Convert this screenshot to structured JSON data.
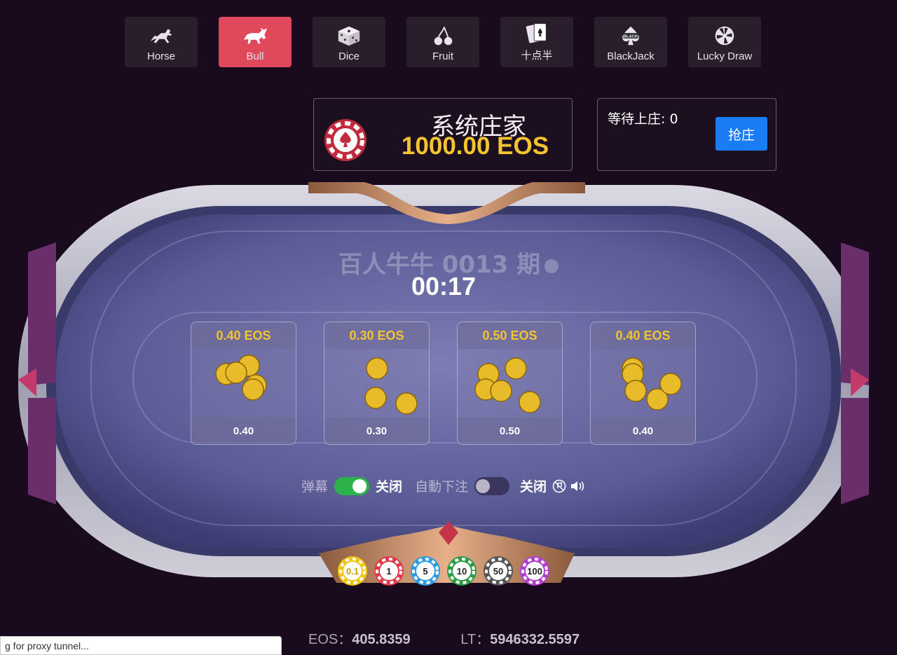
{
  "tabs": [
    {
      "label": "Horse",
      "icon": "horse-icon",
      "active": false
    },
    {
      "label": "Bull",
      "icon": "bull-icon",
      "active": true
    },
    {
      "label": "Dice",
      "icon": "dice-icon",
      "active": false
    },
    {
      "label": "Fruit",
      "icon": "cherry-icon",
      "active": false
    },
    {
      "label": "十点半",
      "icon": "playing-cards-icon",
      "active": false
    },
    {
      "label": "BlackJack",
      "icon": "blackjack-icon",
      "active": false
    },
    {
      "label": "Lucky Draw",
      "icon": "wheel-icon",
      "active": false
    }
  ],
  "banker": {
    "title": "系统庄家",
    "amount": "1000.00 EOS",
    "icon": "poker-chip-icon"
  },
  "queue": {
    "label": "等待上庄: 0",
    "button": "抢庄"
  },
  "round": {
    "title": "百人牛牛 0013 期",
    "timer": "00:17"
  },
  "bets": [
    {
      "header": "0.40 EOS",
      "footer": "0.40"
    },
    {
      "header": "0.30 EOS",
      "footer": "0.30"
    },
    {
      "header": "0.50 EOS",
      "footer": "0.50"
    },
    {
      "header": "0.40 EOS",
      "footer": "0.40"
    }
  ],
  "controls": {
    "barrage_label": "弹幕",
    "barrage_state": "关闭",
    "autobet_label": "自動下注",
    "autobet_state": "关闭"
  },
  "chips": [
    {
      "value": "0.1",
      "color": "#f1c40f"
    },
    {
      "value": "1",
      "color": "#e03a4a"
    },
    {
      "value": "5",
      "color": "#2f9be0"
    },
    {
      "value": "10",
      "color": "#2a9d45"
    },
    {
      "value": "50",
      "color": "#555555"
    },
    {
      "value": "100",
      "color": "#b13fd0"
    }
  ],
  "balances": {
    "eos_label": "EOS：",
    "eos_value": "405.8359",
    "lt_label": "LT：",
    "lt_value": "5946332.5597"
  },
  "status_bar": "g for proxy tunnel...",
  "colors": {
    "accent": "#e0485c",
    "gold": "#f4c430",
    "button_blue": "#1a7cf2",
    "background": "#1a0a1e"
  }
}
